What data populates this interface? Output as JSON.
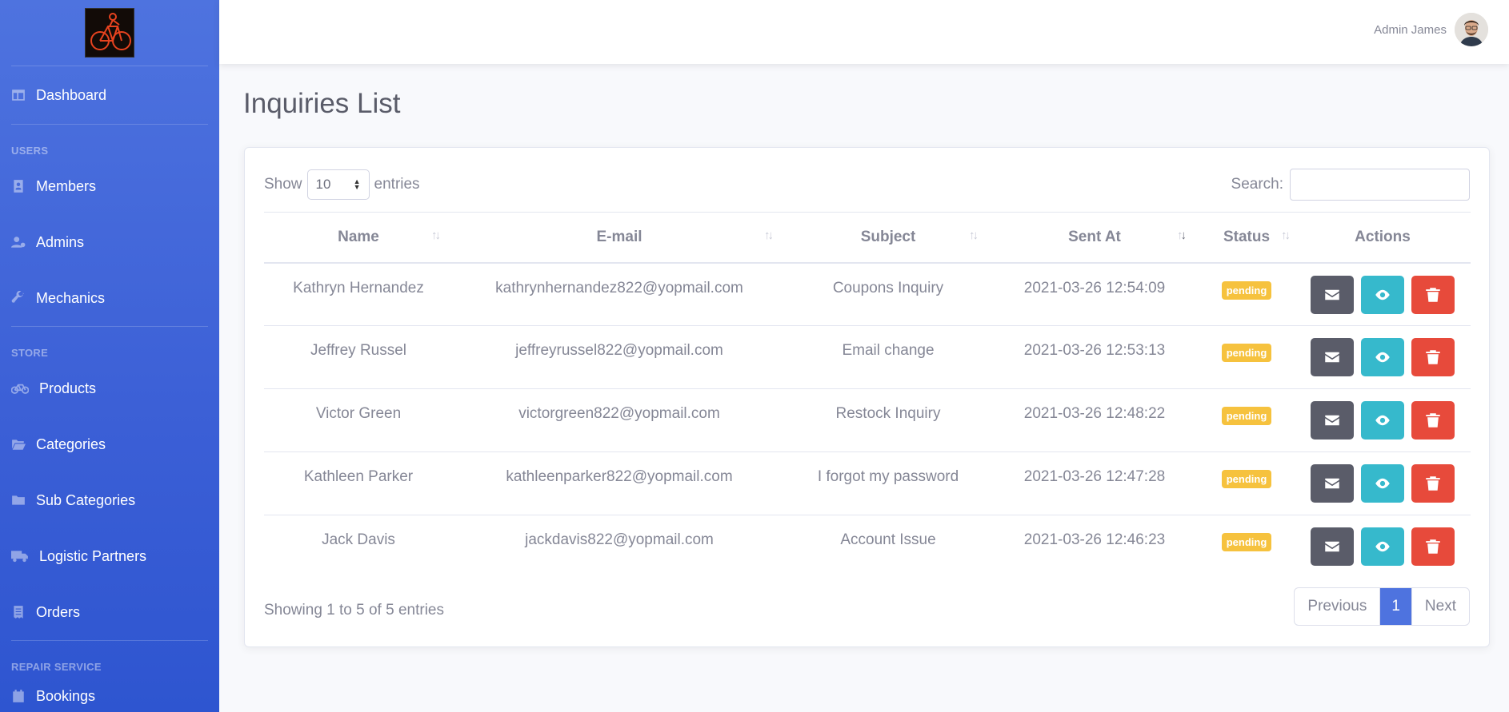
{
  "sidebar": {
    "items": [
      {
        "label": "Dashboard",
        "icon": "dashboard-icon"
      },
      {
        "label": "Members",
        "icon": "id-card-icon"
      },
      {
        "label": "Admins",
        "icon": "user-cog-icon"
      },
      {
        "label": "Mechanics",
        "icon": "wrench-icon"
      },
      {
        "label": "Products",
        "icon": "bicycle-icon"
      },
      {
        "label": "Categories",
        "icon": "folder-open-icon"
      },
      {
        "label": "Sub Categories",
        "icon": "folder-icon"
      },
      {
        "label": "Logistic Partners",
        "icon": "truck-icon"
      },
      {
        "label": "Orders",
        "icon": "receipt-icon"
      },
      {
        "label": "Bookings",
        "icon": "calendar-icon"
      }
    ],
    "sections": {
      "users": "USERS",
      "store": "STORE",
      "repair": "REPAIR SERVICE"
    }
  },
  "topbar": {
    "user_name": "Admin James"
  },
  "page": {
    "title": "Inquiries List"
  },
  "controls": {
    "show_label": "Show",
    "page_size": "10",
    "entries_label": "entries",
    "search_label": "Search:",
    "search_value": ""
  },
  "table": {
    "columns": [
      "Name",
      "E-mail",
      "Subject",
      "Sent At",
      "Status",
      "Actions"
    ],
    "rows": [
      {
        "name": "Kathryn Hernandez",
        "email": "kathrynhernandez822@yopmail.com",
        "subject": "Coupons Inquiry",
        "sent_at": "2021-03-26 12:54:09",
        "status": "pending"
      },
      {
        "name": "Jeffrey Russel",
        "email": "jeffreyrussel822@yopmail.com",
        "subject": "Email change",
        "sent_at": "2021-03-26 12:53:13",
        "status": "pending"
      },
      {
        "name": "Victor Green",
        "email": "victorgreen822@yopmail.com",
        "subject": "Restock Inquiry",
        "sent_at": "2021-03-26 12:48:22",
        "status": "pending"
      },
      {
        "name": "Kathleen Parker",
        "email": "kathleenparker822@yopmail.com",
        "subject": "I forgot my password",
        "sent_at": "2021-03-26 12:47:28",
        "status": "pending"
      },
      {
        "name": "Jack Davis",
        "email": "jackdavis822@yopmail.com",
        "subject": "Account Issue",
        "sent_at": "2021-03-26 12:46:23",
        "status": "pending"
      }
    ]
  },
  "footer": {
    "info": "Showing 1 to 5 of 5 entries",
    "previous": "Previous",
    "page": "1",
    "next": "Next"
  },
  "colors": {
    "sidebar": "#4e73df",
    "badge_pending": "#f6c23e",
    "btn_mail": "#5a5c69",
    "btn_view": "#36b9cc",
    "btn_delete": "#e74a3b"
  }
}
